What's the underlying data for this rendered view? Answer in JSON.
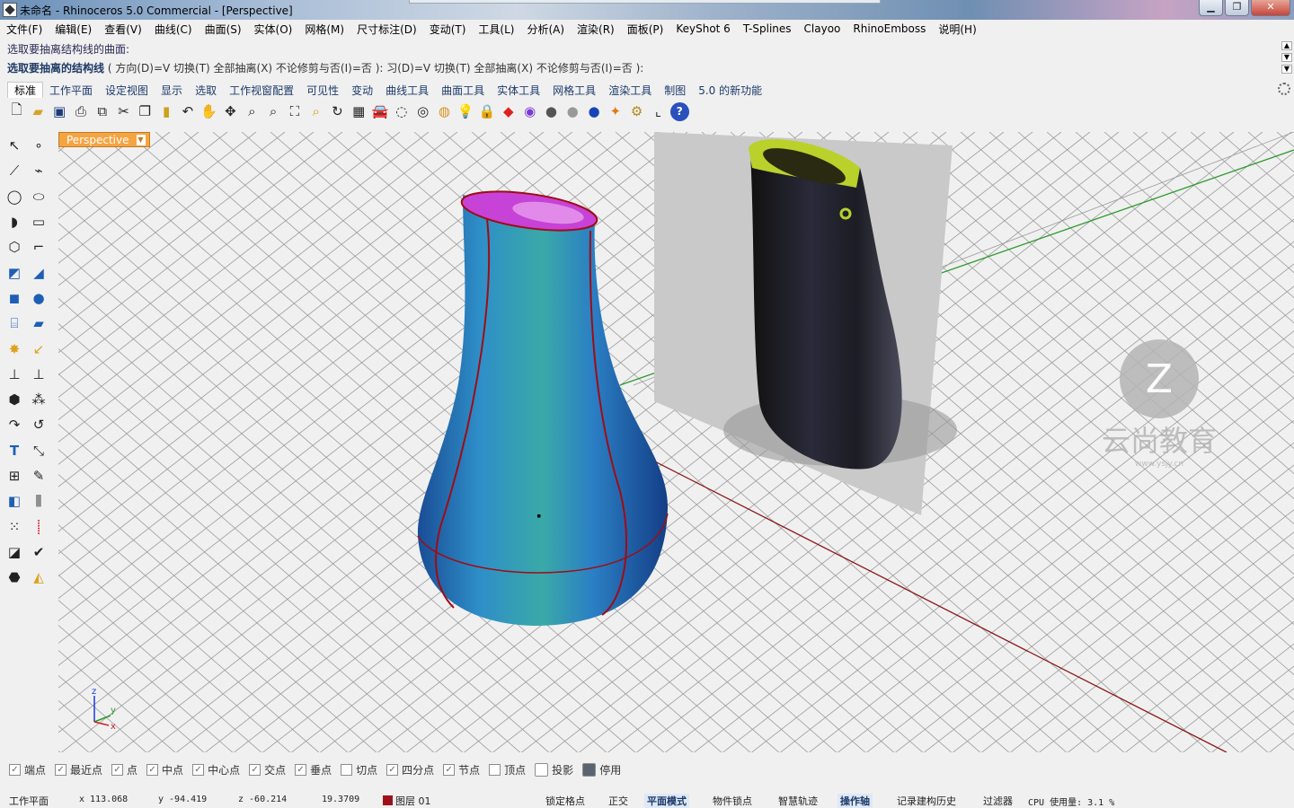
{
  "window": {
    "title": "未命名 - Rhinoceros 5.0 Commercial - [Perspective]",
    "minimize": "▁",
    "maximize": "❐",
    "close": "✕"
  },
  "menu": [
    "文件(F)",
    "编辑(E)",
    "查看(V)",
    "曲线(C)",
    "曲面(S)",
    "实体(O)",
    "网格(M)",
    "尺寸标注(D)",
    "变动(T)",
    "工具(L)",
    "分析(A)",
    "渲染(R)",
    "面板(P)",
    "KeyShot 6",
    "T-Splines",
    "Clayoo",
    "RhinoEmboss",
    "说明(H)"
  ],
  "command": {
    "history": "选取要抽离结构线的曲面:",
    "prompt_label": "选取要抽离的结构线",
    "prompt_options": "( 方向(D)=V  切换(T)   全部抽离(X)   不论修剪与否(I)=否 ): 习(D)=V  切换(T)   全部抽离(X)   不论修剪与否(I)=否 ):"
  },
  "tabs": [
    "标准",
    "工作平面",
    "设定视图",
    "显示",
    "选取",
    "工作视窗配置",
    "可见性",
    "变动",
    "曲线工具",
    "曲面工具",
    "实体工具",
    "网格工具",
    "渲染工具",
    "制图",
    "5.0 的新功能"
  ],
  "active_tab": "标准",
  "toolbar_icons": [
    "new-icon",
    "open-icon",
    "save-icon",
    "print-icon",
    "import-icon",
    "cut-icon",
    "copy-icon",
    "paste-icon",
    "undo-icon",
    "pan-icon",
    "rotate-view-icon",
    "zoom-icon",
    "zoom-window-icon",
    "zoom-extents-icon",
    "zoom-selected-icon",
    "rotate-camera-icon",
    "four-viewports-icon",
    "car-icon",
    "wireframe-icon",
    "shaded-icon",
    "render-icon",
    "light-icon",
    "lock-icon",
    "material-icon",
    "color-wheel-icon",
    "sphere-gray-icon",
    "sphere-white-icon",
    "sphere-blue-icon",
    "keyshot-icon",
    "settings-icon",
    "gumball-icon",
    "help-icon"
  ],
  "viewport": {
    "label": "Perspective",
    "axis_x": "x",
    "axis_y": "y",
    "axis_z": "z",
    "watermark_main": "云尚教育",
    "watermark_sub": "www.ysjy.cn"
  },
  "osnaps": [
    {
      "label": "端点",
      "checked": true
    },
    {
      "label": "最近点",
      "checked": true
    },
    {
      "label": "点",
      "checked": true
    },
    {
      "label": "中点",
      "checked": true
    },
    {
      "label": "中心点",
      "checked": true
    },
    {
      "label": "交点",
      "checked": true
    },
    {
      "label": "垂点",
      "checked": true
    },
    {
      "label": "切点",
      "checked": false
    },
    {
      "label": "四分点",
      "checked": true
    },
    {
      "label": "节点",
      "checked": true
    },
    {
      "label": "顶点",
      "checked": false
    },
    {
      "label": "投影",
      "checked": false
    },
    {
      "label": "停用",
      "checked": false
    }
  ],
  "status": {
    "cplane": "工作平面",
    "x": "x 113.068",
    "y": "y -94.419",
    "z": "z -60.214",
    "distance": "19.3709",
    "layer": "图层 01",
    "grid_snap": "锁定格点",
    "ortho": "正交",
    "planar": "平面模式",
    "osnap": "物件锁点",
    "smarttrack": "智慧轨迹",
    "gumball": "操作轴",
    "history": "记录建构历史",
    "filter": "过滤器",
    "cpu": "CPU 使用量: 3.1 %"
  },
  "colors": {
    "viewport_tab": "#f5a442",
    "vase_body": "#2e8fc8",
    "vase_interior": "#c742d6",
    "seam": "#a00c14",
    "x_axis": "#8b1a1a",
    "y_axis": "#2e9a2e"
  }
}
